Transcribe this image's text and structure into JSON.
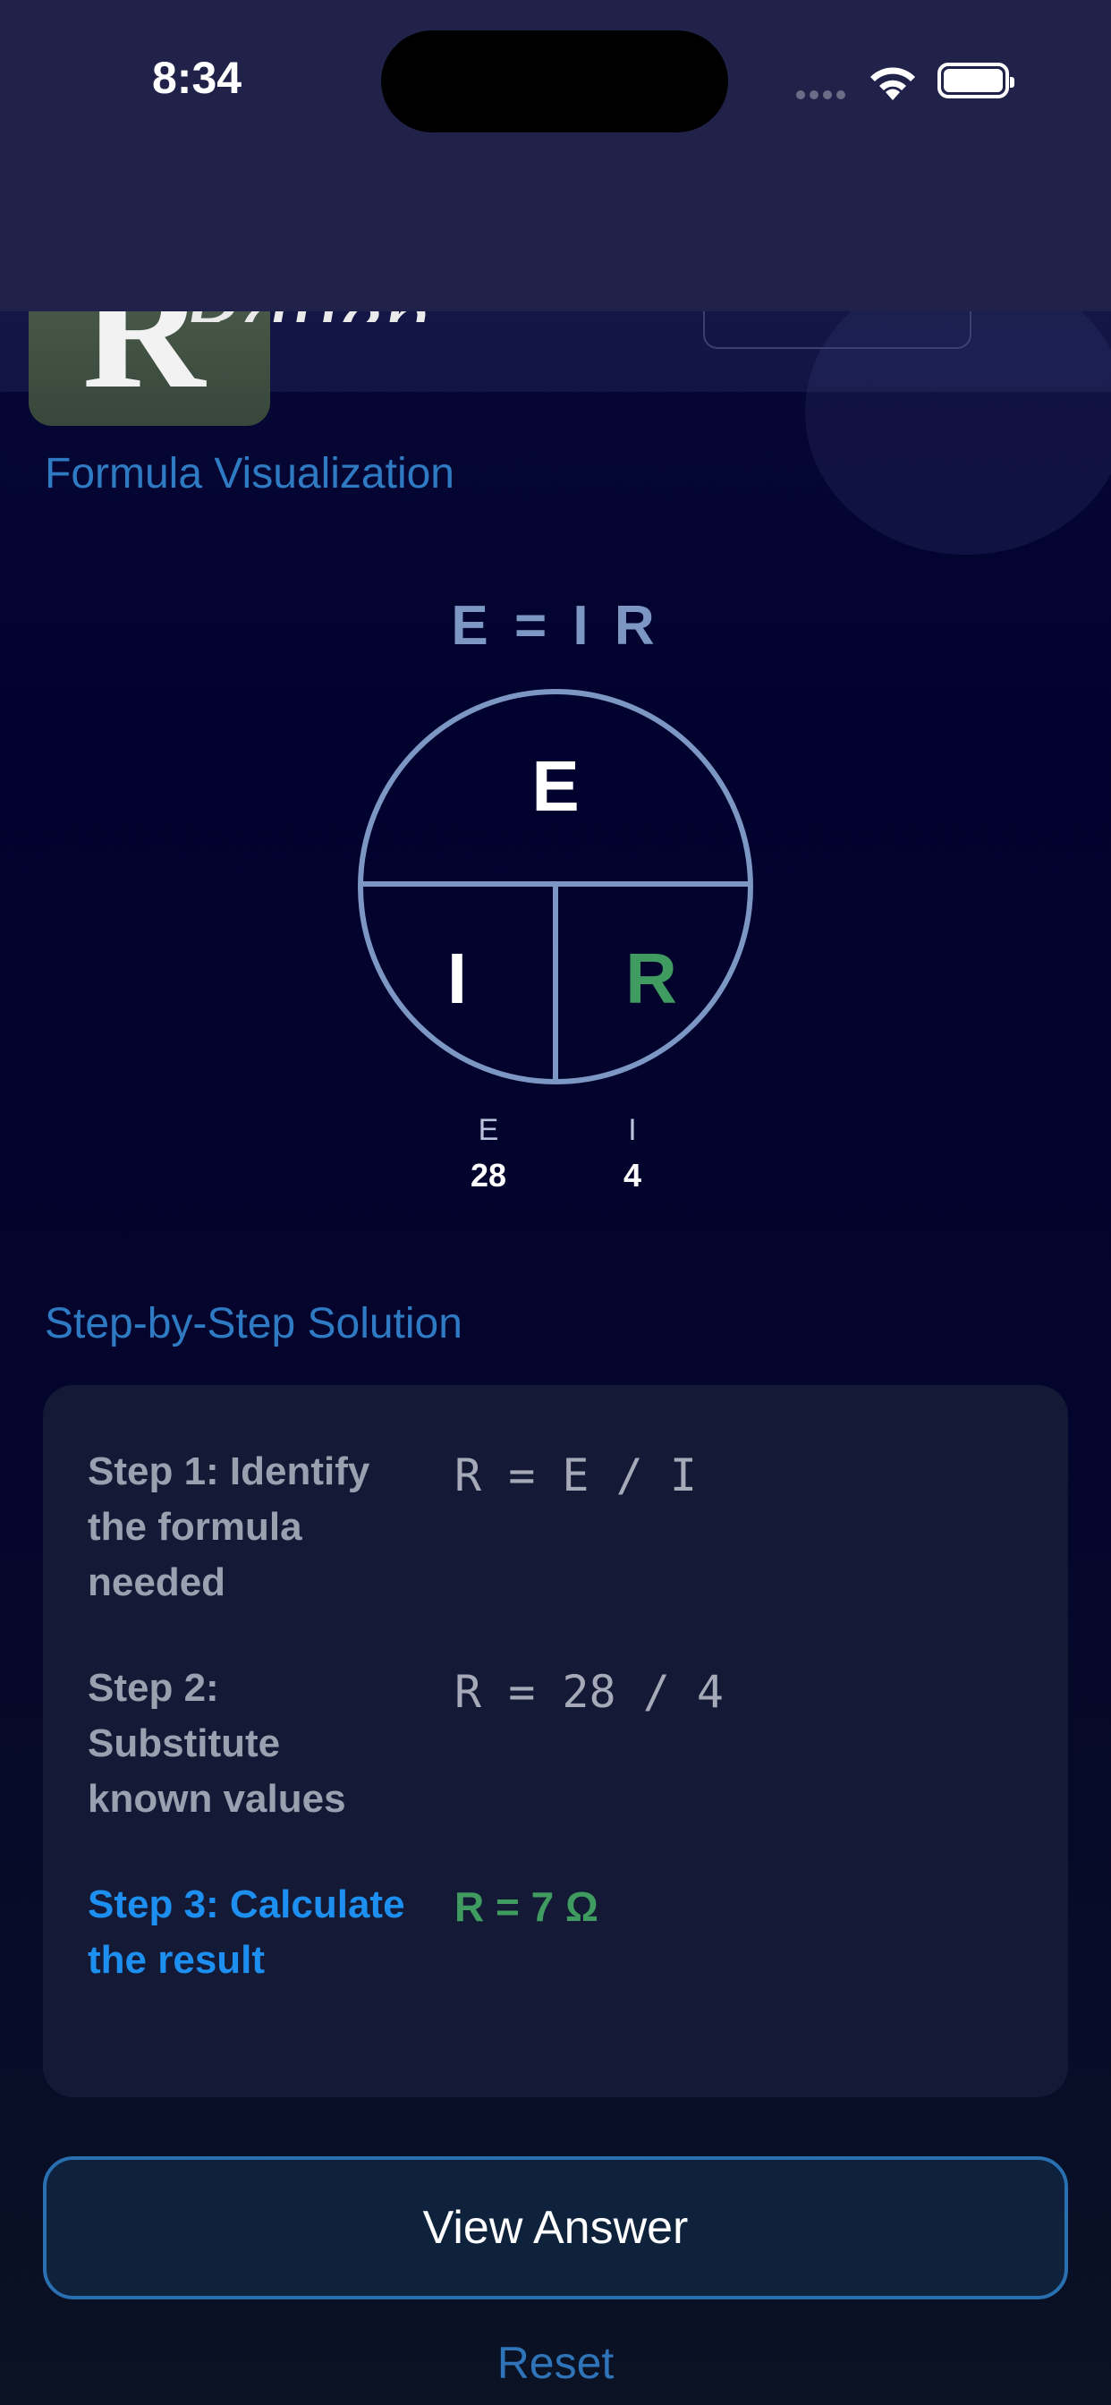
{
  "status": {
    "time": "8:34"
  },
  "header": {
    "logo_letter": "R",
    "logo_script": "Rauen"
  },
  "visualization": {
    "section_title": "Formula Visualization",
    "formula": "E = I R",
    "circle": {
      "top": "E",
      "bottom_left": "I",
      "bottom_right": "R",
      "highlight_color": "#3f9b5f"
    },
    "values": [
      {
        "label": "E",
        "value": "28"
      },
      {
        "label": "I",
        "value": "4"
      }
    ]
  },
  "solution": {
    "section_title": "Step-by-Step Solution",
    "steps": [
      {
        "title": "Step 1: Identify the formula needed",
        "formula": "R = E / I"
      },
      {
        "title": "Step 2: Substitute known values",
        "formula": "R = 28 / 4"
      },
      {
        "title": "Step 3: Calculate the result",
        "formula": "R = 7 Ω"
      }
    ]
  },
  "actions": {
    "view_answer": "View Answer",
    "reset": "Reset"
  }
}
